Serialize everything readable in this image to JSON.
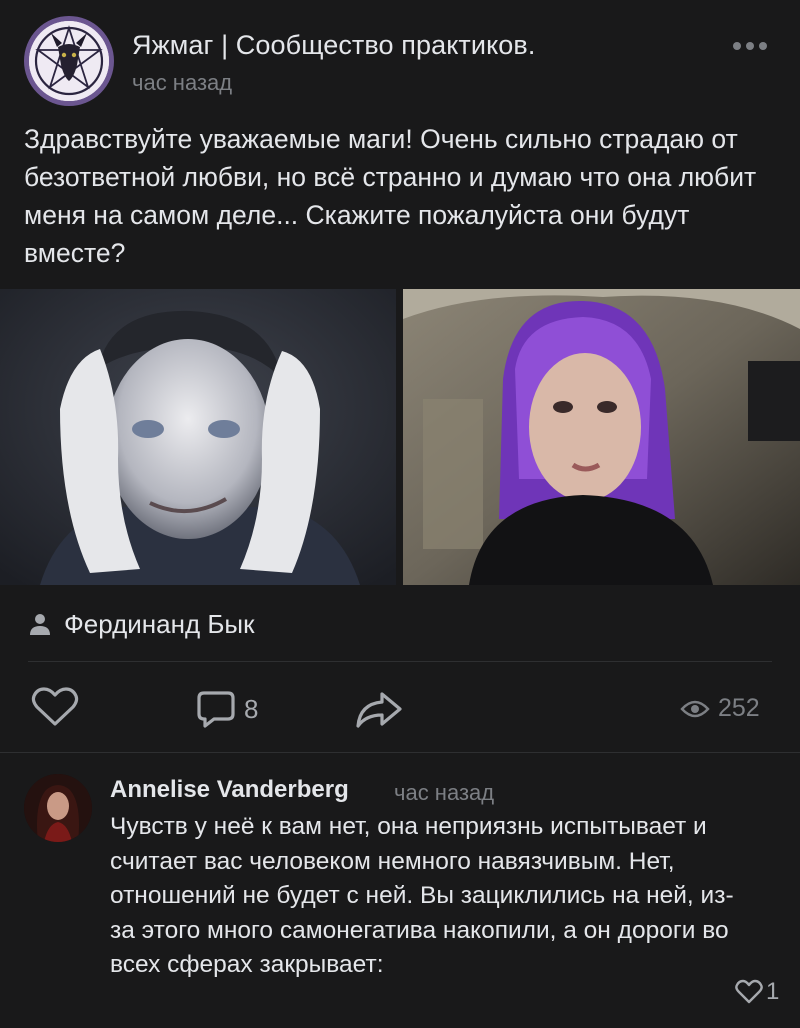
{
  "post": {
    "group_name": "Яжмаг | Сообщество практиков.",
    "time": "час назад",
    "text": "Здравствуйте уважаемые маги! Очень сильно страдаю от безответной любви, но всё странно и думаю что она любит меня на самом деле... Скажите пожалуйста они будут вместе?",
    "author": "Фердинанд Бык",
    "comments_count": "8",
    "views_count": "252"
  },
  "comment": {
    "author": "Annelise Vanderberg",
    "time": "час назад",
    "text": "Чувств у неё к вам нет, она неприязнь испытывает и считает вас человеком немного навязчивым. Нет, отношений не будет с ней. Вы зациклились на ней, из-за этого много самонегатива накопили, а он дороги во всех сферах закрывает:",
    "likes": "1"
  },
  "icons": {
    "more": "more-horizontal-icon",
    "author": "user-icon",
    "like": "heart-icon",
    "comment": "comment-bubble-icon",
    "share": "share-arrow-icon",
    "views": "eye-icon"
  },
  "colors": {
    "background": "#19191a",
    "text": "#e4e6ea",
    "secondary": "#7c7f84",
    "avatar_ring": "#6b5690"
  }
}
